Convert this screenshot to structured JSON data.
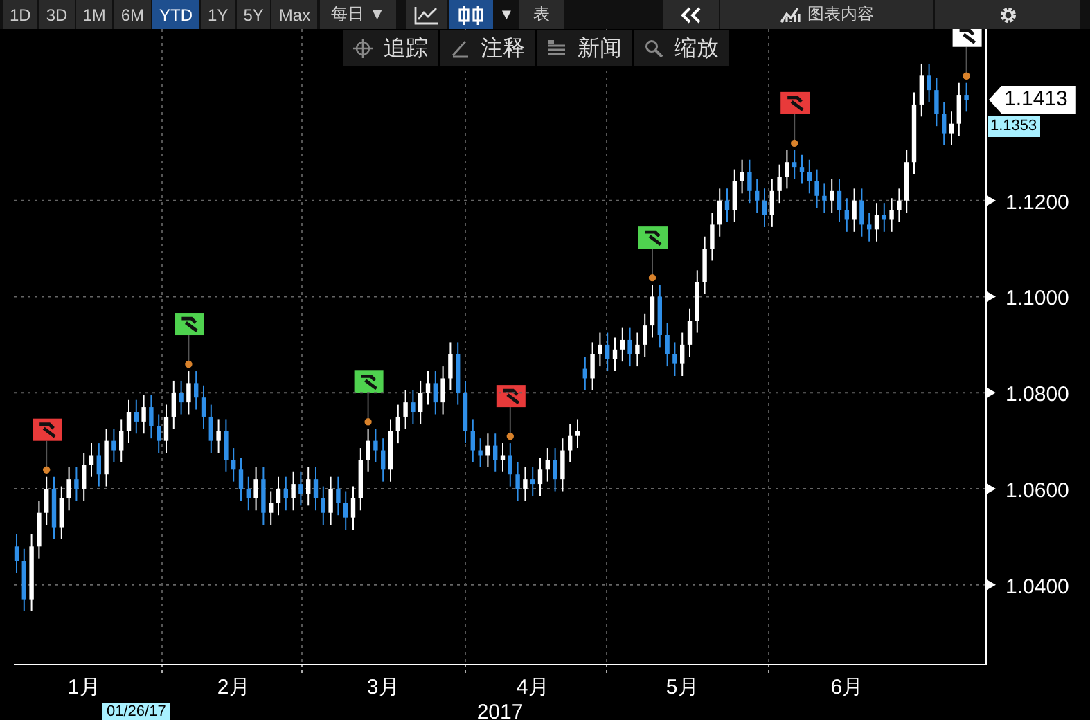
{
  "toolbar": {
    "ranges": [
      {
        "label": "1D",
        "selected": false
      },
      {
        "label": "3D",
        "selected": false
      },
      {
        "label": "1M",
        "selected": false
      },
      {
        "label": "6M",
        "selected": false
      },
      {
        "label": "YTD",
        "selected": true
      },
      {
        "label": "1Y",
        "selected": false
      },
      {
        "label": "5Y",
        "selected": false
      },
      {
        "label": "Max",
        "selected": false
      }
    ],
    "frequency": "每日",
    "frequency_caret": "▼",
    "chart_types": [
      {
        "kind": "line",
        "selected": false
      },
      {
        "kind": "candle",
        "selected": true
      }
    ],
    "chart_type_caret": "▼",
    "table": "表",
    "chart_contents": "图表内容"
  },
  "tools": [
    {
      "kind": "track",
      "label": "追踪"
    },
    {
      "kind": "annotate",
      "label": "注释"
    },
    {
      "kind": "news",
      "label": "新闻"
    },
    {
      "kind": "zoom",
      "label": "缩放"
    }
  ],
  "chart": {
    "last_price": "1.1413",
    "price_label": "1.1353",
    "cursor_date": "01/26/17",
    "flags": [
      {
        "color": "#e83a3a"
      },
      {
        "color": "#4fd24f"
      },
      {
        "color": "#4fd24f"
      },
      {
        "color": "#e83a3a"
      },
      {
        "color": "#4fd24f"
      },
      {
        "color": "#e83a3a"
      },
      {
        "color": "#ffffff"
      }
    ],
    "chart_data": {
      "type": "candlestick",
      "xlabel": "2017",
      "grid": true,
      "ylim": [
        1.0234,
        1.1557
      ],
      "yticks": [
        {
          "value": 1.04,
          "label": "1.0400"
        },
        {
          "value": 1.06,
          "label": "1.0600"
        },
        {
          "value": 1.08,
          "label": "1.0800"
        },
        {
          "value": 1.1,
          "label": "1.1000"
        },
        {
          "value": 1.12,
          "label": "1.1200"
        }
      ],
      "categories": [
        null,
        null,
        null,
        null,
        null,
        null,
        null,
        null,
        null,
        "1月",
        null,
        null,
        null,
        null,
        null,
        null,
        null,
        null,
        null,
        null,
        null,
        null,
        null,
        null,
        null,
        null,
        null,
        null,
        null,
        "2月",
        null,
        null,
        null,
        null,
        null,
        null,
        null,
        null,
        null,
        null,
        null,
        null,
        null,
        null,
        null,
        null,
        null,
        null,
        null,
        "3月",
        null,
        null,
        null,
        null,
        null,
        null,
        null,
        null,
        null,
        null,
        null,
        null,
        null,
        null,
        null,
        null,
        null,
        null,
        null,
        "4月",
        null,
        null,
        null,
        null,
        null,
        null,
        null,
        null,
        null,
        null,
        null,
        null,
        null,
        null,
        null,
        null,
        null,
        null,
        null,
        "5月",
        null,
        null,
        null,
        null,
        null,
        null,
        null,
        null,
        null,
        null,
        null,
        null,
        null,
        null,
        null,
        null,
        null,
        null,
        null,
        null,
        null,
        "6月",
        null,
        null,
        null,
        null,
        null,
        null,
        null,
        null,
        null,
        null,
        null,
        null,
        null,
        null,
        null,
        null
      ],
      "ohlc": [
        [
          1.048,
          1.0505,
          1.0425,
          1.045
        ],
        [
          1.045,
          1.0475,
          1.0345,
          1.037
        ],
        [
          1.037,
          1.0505,
          1.0345,
          1.048
        ],
        [
          1.048,
          1.0575,
          1.0455,
          1.055
        ],
        [
          1.055,
          1.0625,
          1.0525,
          1.06
        ],
        [
          1.06,
          1.0625,
          1.0495,
          1.052
        ],
        [
          1.052,
          1.0605,
          1.0495,
          1.058
        ],
        [
          1.058,
          1.0645,
          1.0555,
          1.062
        ],
        [
          1.062,
          1.0645,
          1.0575,
          1.06
        ],
        [
          1.06,
          1.0675,
          1.0575,
          1.065
        ],
        [
          1.065,
          1.0695,
          1.0625,
          1.067
        ],
        [
          1.067,
          1.0695,
          1.0605,
          1.063
        ],
        [
          1.063,
          1.0725,
          1.0605,
          1.07
        ],
        [
          1.07,
          1.0725,
          1.0655,
          1.068
        ],
        [
          1.068,
          1.0745,
          1.0655,
          1.072
        ],
        [
          1.072,
          1.0785,
          1.0695,
          1.076
        ],
        [
          1.076,
          1.0785,
          1.0715,
          1.074
        ],
        [
          1.074,
          1.0795,
          1.0715,
          1.077
        ],
        [
          1.077,
          1.0795,
          1.0705,
          1.073
        ],
        [
          1.073,
          1.0755,
          1.0675,
          1.07
        ],
        [
          1.07,
          1.0775,
          1.0675,
          1.075
        ],
        [
          1.075,
          1.0825,
          1.0725,
          1.08
        ],
        [
          1.08,
          1.0825,
          1.0755,
          1.078
        ],
        [
          1.078,
          1.0845,
          1.0755,
          1.082
        ],
        [
          1.082,
          1.0845,
          1.0765,
          1.079
        ],
        [
          1.079,
          1.0815,
          1.0725,
          1.075
        ],
        [
          1.075,
          1.0775,
          1.0675,
          1.07
        ],
        [
          1.07,
          1.0745,
          1.0675,
          1.072
        ],
        [
          1.072,
          1.0745,
          1.0635,
          1.066
        ],
        [
          1.066,
          1.0685,
          1.0615,
          1.064
        ],
        [
          1.064,
          1.0665,
          1.0575,
          1.06
        ],
        [
          1.06,
          1.0625,
          1.0555,
          1.058
        ],
        [
          1.058,
          1.0645,
          1.0555,
          1.062
        ],
        [
          1.062,
          1.0645,
          1.0525,
          1.055
        ],
        [
          1.055,
          1.0595,
          1.0525,
          1.057
        ],
        [
          1.057,
          1.0625,
          1.0545,
          1.06
        ],
        [
          1.06,
          1.0625,
          1.0555,
          1.058
        ],
        [
          1.058,
          1.0635,
          1.0555,
          1.061
        ],
        [
          1.061,
          1.0635,
          1.0565,
          1.059
        ],
        [
          1.059,
          1.0645,
          1.0565,
          1.062
        ],
        [
          1.062,
          1.0645,
          1.0555,
          1.058
        ],
        [
          1.058,
          1.0605,
          1.0525,
          1.055
        ],
        [
          1.055,
          1.0625,
          1.0525,
          1.06
        ],
        [
          1.06,
          1.0625,
          1.0545,
          1.057
        ],
        [
          1.057,
          1.0595,
          1.0515,
          1.054
        ],
        [
          1.054,
          1.0605,
          1.0515,
          1.058
        ],
        [
          1.058,
          1.0685,
          1.0555,
          1.066
        ],
        [
          1.066,
          1.0725,
          1.0635,
          1.07
        ],
        [
          1.07,
          1.0725,
          1.0655,
          1.068
        ],
        [
          1.068,
          1.0705,
          1.0615,
          1.064
        ],
        [
          1.064,
          1.0745,
          1.0615,
          1.072
        ],
        [
          1.072,
          1.0775,
          1.0695,
          1.075
        ],
        [
          1.075,
          1.0805,
          1.0725,
          1.078
        ],
        [
          1.078,
          1.0805,
          1.0735,
          1.076
        ],
        [
          1.076,
          1.0825,
          1.0735,
          1.08
        ],
        [
          1.08,
          1.0845,
          1.0775,
          1.082
        ],
        [
          1.082,
          1.0845,
          1.0755,
          1.078
        ],
        [
          1.078,
          1.0855,
          1.0755,
          1.083
        ],
        [
          1.083,
          1.0905,
          1.0805,
          1.088
        ],
        [
          1.088,
          1.0905,
          1.0775,
          1.08
        ],
        [
          1.08,
          1.0825,
          1.0695,
          1.072
        ],
        [
          1.072,
          1.0745,
          1.0655,
          1.068
        ],
        [
          1.068,
          1.0705,
          1.0645,
          1.067
        ],
        [
          1.067,
          1.0715,
          1.0645,
          1.069
        ],
        [
          1.069,
          1.0715,
          1.0635,
          1.066
        ],
        [
          1.066,
          1.0695,
          1.0635,
          1.067
        ],
        [
          1.067,
          1.0695,
          1.0605,
          1.063
        ],
        [
          1.063,
          1.0655,
          1.0575,
          1.06
        ],
        [
          1.06,
          1.0645,
          1.0575,
          1.062
        ],
        [
          1.062,
          1.0645,
          1.0585,
          1.061
        ],
        [
          1.061,
          1.0665,
          1.0585,
          1.064
        ],
        [
          1.064,
          1.0685,
          1.0615,
          1.066
        ],
        [
          1.066,
          1.0685,
          1.0595,
          1.062
        ],
        [
          1.062,
          1.0705,
          1.0595,
          1.068
        ],
        [
          1.068,
          1.0735,
          1.0655,
          1.071
        ],
        [
          1.071,
          1.0745,
          1.0685,
          1.072
        ],
        [
          1.085,
          1.0875,
          1.0805,
          1.083
        ],
        [
          1.083,
          1.0905,
          1.0805,
          1.088
        ],
        [
          1.088,
          1.0925,
          1.0855,
          1.09
        ],
        [
          1.09,
          1.0925,
          1.0845,
          1.087
        ],
        [
          1.087,
          1.0915,
          1.0845,
          1.089
        ],
        [
          1.089,
          1.0935,
          1.0865,
          1.091
        ],
        [
          1.091,
          1.0935,
          1.0855,
          1.088
        ],
        [
          1.088,
          1.0925,
          1.0855,
          1.09
        ],
        [
          1.09,
          1.0965,
          1.0875,
          1.094
        ],
        [
          1.094,
          1.1025,
          1.0915,
          1.1
        ],
        [
          1.1,
          1.1025,
          1.0895,
          1.092
        ],
        [
          1.092,
          1.0945,
          1.0855,
          1.088
        ],
        [
          1.088,
          1.0905,
          1.0835,
          1.086
        ],
        [
          1.086,
          1.0925,
          1.0835,
          1.09
        ],
        [
          1.09,
          1.0975,
          1.0875,
          1.095
        ],
        [
          1.095,
          1.1055,
          1.0925,
          1.103
        ],
        [
          1.103,
          1.1125,
          1.1005,
          1.11
        ],
        [
          1.11,
          1.1175,
          1.1075,
          1.115
        ],
        [
          1.115,
          1.1225,
          1.1125,
          1.12
        ],
        [
          1.12,
          1.1225,
          1.1155,
          1.118
        ],
        [
          1.118,
          1.1265,
          1.1155,
          1.124
        ],
        [
          1.124,
          1.1285,
          1.1215,
          1.126
        ],
        [
          1.126,
          1.1285,
          1.1195,
          1.122
        ],
        [
          1.122,
          1.1245,
          1.1175,
          1.12
        ],
        [
          1.12,
          1.1225,
          1.1145,
          1.117
        ],
        [
          1.117,
          1.1245,
          1.1145,
          1.122
        ],
        [
          1.122,
          1.1275,
          1.1195,
          1.125
        ],
        [
          1.125,
          1.1305,
          1.1225,
          1.128
        ],
        [
          1.128,
          1.1305,
          1.1245,
          1.127
        ],
        [
          1.127,
          1.1295,
          1.1235,
          1.126
        ],
        [
          1.126,
          1.1285,
          1.1215,
          1.124
        ],
        [
          1.124,
          1.1265,
          1.1185,
          1.121
        ],
        [
          1.121,
          1.1235,
          1.1175,
          1.12
        ],
        [
          1.12,
          1.1245,
          1.1175,
          1.122
        ],
        [
          1.122,
          1.1245,
          1.1155,
          1.118
        ],
        [
          1.118,
          1.1205,
          1.1135,
          1.116
        ],
        [
          1.116,
          1.1225,
          1.1135,
          1.12
        ],
        [
          1.12,
          1.1225,
          1.1125,
          1.115
        ],
        [
          1.115,
          1.1175,
          1.1115,
          1.114
        ],
        [
          1.114,
          1.1195,
          1.1115,
          1.117
        ],
        [
          1.117,
          1.1195,
          1.1135,
          1.116
        ],
        [
          1.116,
          1.1205,
          1.1135,
          1.118
        ],
        [
          1.118,
          1.1225,
          1.1155,
          1.12
        ],
        [
          1.12,
          1.1305,
          1.1175,
          1.128
        ],
        [
          1.128,
          1.1425,
          1.1255,
          1.14
        ],
        [
          1.14,
          1.1485,
          1.1375,
          1.146
        ],
        [
          1.146,
          1.1485,
          1.1405,
          1.143
        ],
        [
          1.143,
          1.1455,
          1.1355,
          1.138
        ],
        [
          1.138,
          1.1405,
          1.1315,
          1.134
        ],
        [
          1.134,
          1.1385,
          1.1315,
          1.136
        ],
        [
          1.136,
          1.1445,
          1.1335,
          1.142
        ],
        [
          1.142,
          1.1445,
          1.1385,
          1.141
        ]
      ]
    }
  }
}
